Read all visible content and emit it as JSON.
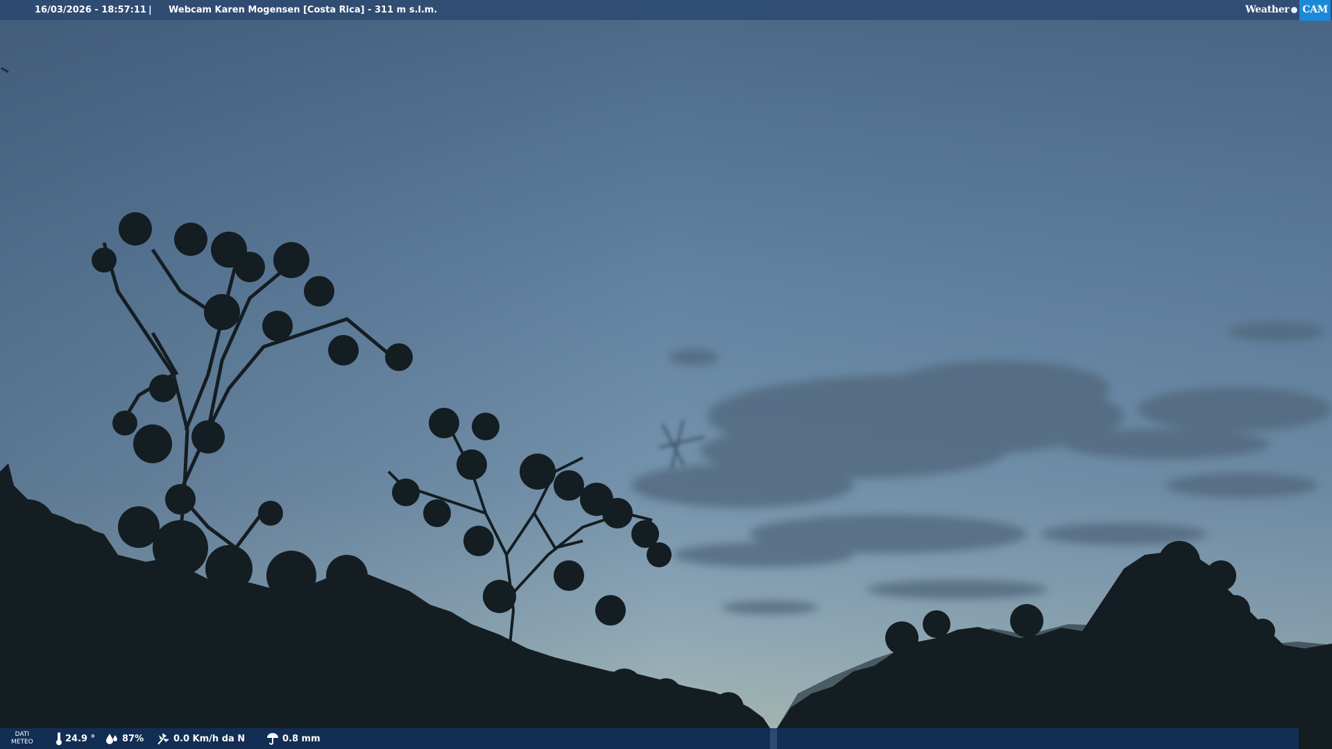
{
  "overlay": {
    "timestamp": "16/03/2026 - 18:57:11",
    "separator": "|",
    "title": "Webcam Karen Mogensen [Costa Rica] - 311 m s.l.m.",
    "logo_word": "Weather",
    "logo_cam": "CAM"
  },
  "weather": {
    "label_line1": "DATI",
    "label_line2": "METEO",
    "temperature": "24.9 °",
    "humidity": "87%",
    "wind": "0.0 Km/h da N",
    "rain": "0.8 mm",
    "icons": [
      "thermometer-icon",
      "humidity-drops-icon",
      "wind-icon",
      "rain-icon"
    ]
  },
  "colors": {
    "sky_top": "#4c6a89",
    "sky_mid": "#6684a2",
    "sky_horizon": "#9cb4b8",
    "vegetation": "#141d22",
    "bar": "#2a466e",
    "logo_accent": "#1a8ad8"
  }
}
